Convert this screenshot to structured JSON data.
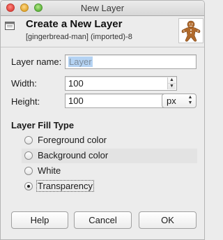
{
  "window": {
    "title": "New Layer"
  },
  "header": {
    "title": "Create a New Layer",
    "subtitle": "[gingerbread-man] (imported)-8",
    "image_icon": "gingerbread-man-thumbnail",
    "layer_icon": "layer-icon"
  },
  "form": {
    "layer_name_label": "Layer name:",
    "layer_name_value": "Layer",
    "width_label": "Width:",
    "width_value": "100",
    "height_label": "Height:",
    "height_value": "100",
    "unit_value": "px"
  },
  "fill": {
    "title": "Layer Fill Type",
    "options": [
      {
        "label": "Foreground color",
        "checked": false
      },
      {
        "label": "Background color",
        "checked": false
      },
      {
        "label": "White",
        "checked": false
      },
      {
        "label": "Transparency",
        "checked": true
      }
    ]
  },
  "buttons": {
    "help": "Help",
    "cancel": "Cancel",
    "ok": "OK"
  }
}
